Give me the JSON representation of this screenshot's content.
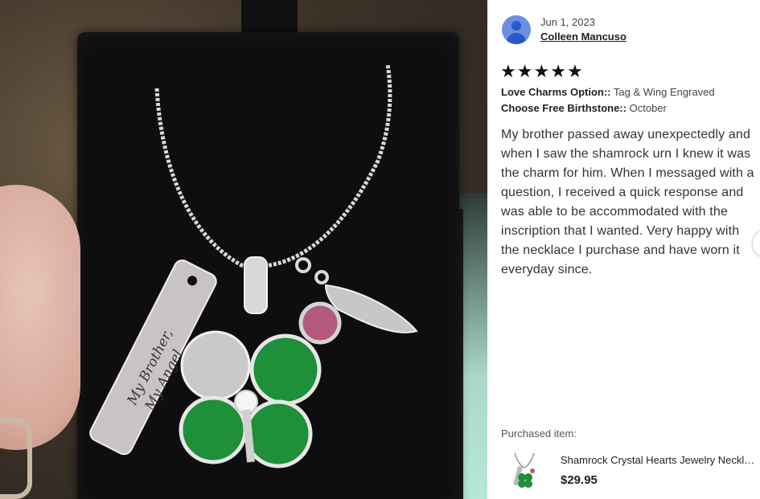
{
  "review": {
    "date": "Jun 1, 2023",
    "author": "Colleen Mancuso",
    "rating": 5,
    "stars": [
      "★",
      "★",
      "★",
      "★",
      "★"
    ],
    "options": [
      {
        "label": "Love Charms Option::",
        "value": "Tag & Wing Engraved"
      },
      {
        "label": "Choose Free Birthstone::",
        "value": "October"
      }
    ],
    "text": "My brother passed away unexpectedly and when I saw the shamrock urn I knew it was the charm for him. When I messaged with a question, I received a quick response and was able to be accommodated with the inscription that I wanted. Very happy with the necklace I purchase and have worn it everyday since."
  },
  "purchase": {
    "label": "Purchased item:",
    "title": "Shamrock Crystal Hearts Jewelry Necklace",
    "price": "$29.95"
  },
  "photo": {
    "tag_engraving_line1": "My Brother,",
    "tag_engraving_line2": "My Angel"
  },
  "colors": {
    "avatar_bg": "#6b8fe3",
    "avatar_fg": "#2b58c9",
    "star": "#111111",
    "shamrock_green": "#1f8f3a",
    "birthstone": "#b35a7c"
  }
}
